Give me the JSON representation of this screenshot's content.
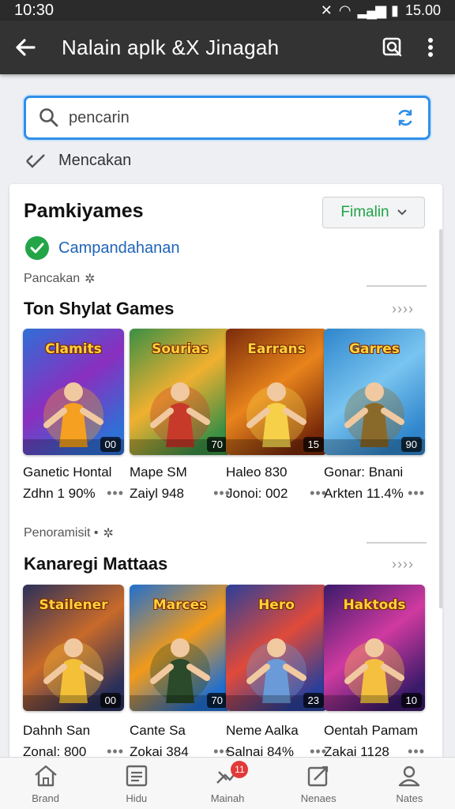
{
  "status": {
    "time": "10:30",
    "clock": "15.00"
  },
  "appbar": {
    "title": "Nalain aplk &X Jinagah"
  },
  "search": {
    "value": "pencarin",
    "placeholder": "pencarin"
  },
  "hint": {
    "label": "Mencakan"
  },
  "card": {
    "title": "Pamkiyames",
    "filter_label": "Fimalin",
    "verified_label": "Campandahanan"
  },
  "sections": [
    {
      "subhead": "Pancakan",
      "title": "Ton Shylat Games",
      "more": "››››",
      "items": [
        {
          "art": "Clamits",
          "badge": "00",
          "name": "Ganetic Hontal",
          "sub": "Zdhn 1 90%",
          "colors": [
            "#2f6fd6",
            "#8a2fbf",
            "#f5a020"
          ]
        },
        {
          "art": "Sourias",
          "badge": "70",
          "name": "Mape SM",
          "sub": "Zaiyl 948",
          "colors": [
            "#3a8f45",
            "#f0b030",
            "#c73a2a"
          ]
        },
        {
          "art": "Earrans",
          "badge": "15",
          "name": "Haleo 830",
          "sub": "Jonoi: 002",
          "colors": [
            "#7a2a0a",
            "#e8841c",
            "#f6d048"
          ]
        },
        {
          "art": "Garres",
          "badge": "90",
          "name": "Gonar: Bnani",
          "sub": "Arkten 11.4%",
          "colors": [
            "#2f86cc",
            "#79c4f0",
            "#8a6a2a"
          ]
        }
      ]
    },
    {
      "subhead": "Penoramisit •",
      "title": "Kanaregi Mattaas",
      "more": "››››",
      "items": [
        {
          "art": "Stailener",
          "badge": "00",
          "name": "Dahnh San",
          "sub": "Zonal: 800",
          "colors": [
            "#2a2f5a",
            "#c86a2a",
            "#f4c038"
          ]
        },
        {
          "art": "Marces",
          "badge": "70",
          "name": "Cante Sa",
          "sub": "Zokai 384",
          "colors": [
            "#1f6fd0",
            "#f29a1a",
            "#2a4a2a"
          ]
        },
        {
          "art": "Hero",
          "badge": "23",
          "name": "Neme Aalka",
          "sub": "Salnai 84%",
          "colors": [
            "#2a3f9a",
            "#e04a3a",
            "#6a9ad8"
          ]
        },
        {
          "art": "Haktods",
          "badge": "10",
          "name": "Oentah Pamam",
          "sub": "Zakai 1128",
          "colors": [
            "#3a1a6a",
            "#d03aa0",
            "#f5c040"
          ]
        }
      ]
    }
  ],
  "nav": [
    {
      "label": "Brand",
      "icon": "home-icon"
    },
    {
      "label": "Hidu",
      "icon": "list-icon"
    },
    {
      "label": "Mainah",
      "icon": "feed-icon",
      "badge": "11"
    },
    {
      "label": "Nenaes",
      "icon": "edit-icon"
    },
    {
      "label": "Nates",
      "icon": "profile-icon"
    }
  ]
}
